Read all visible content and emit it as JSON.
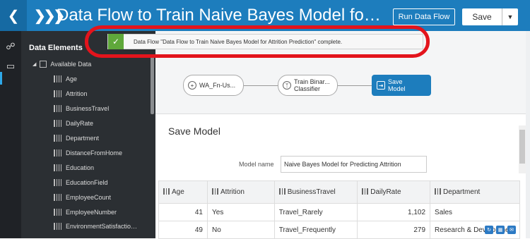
{
  "header": {
    "title": "Data Flow to Train Naive Bayes Model for Attrition Prediction",
    "run_label": "Run Data Flow",
    "save_label": "Save"
  },
  "sidebar": {
    "title": "Data Elements",
    "root_label": "Available Data",
    "fields": [
      "Age",
      "Attrition",
      "BusinessTravel",
      "DailyRate",
      "Department",
      "DistanceFromHome",
      "Education",
      "EducationField",
      "EmployeeCount",
      "EmployeeNumber",
      "EnvironmentSatisfactio…"
    ]
  },
  "notification": {
    "text": "Data Flow \"Data Flow to Train Naive Bayes Model for Attrition Prediction\" complete."
  },
  "flow": {
    "nodes": [
      {
        "label": "WA_Fn-Us..."
      },
      {
        "label": "Train Binar...\nClassifier"
      },
      {
        "label": "Save\nModel"
      }
    ]
  },
  "panel": {
    "title": "Save Model",
    "model_name_label": "Model name",
    "model_name_value": "Naive Bayes Model for Predicting Attrition"
  },
  "table": {
    "columns": [
      "Age",
      "Attrition",
      "BusinessTravel",
      "DailyRate",
      "Department"
    ],
    "rows": [
      [
        "41",
        "Yes",
        "Travel_Rarely",
        "1,102",
        "Sales"
      ],
      [
        "49",
        "No",
        "Travel_Frequently",
        "279",
        "Research & Development"
      ]
    ]
  },
  "colors": {
    "header": "#1d7dbd",
    "sidebar": "#2b2f33",
    "success": "#5fa83b",
    "annotation": "#e3141c"
  }
}
